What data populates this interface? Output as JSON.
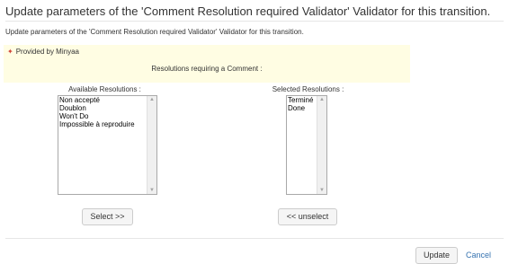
{
  "dialog": {
    "title": "Update parameters of the 'Comment Resolution required Validator' Validator for this transition.",
    "description": "Update parameters of the 'Comment Resolution required Validator' Validator for this transition."
  },
  "plugin": {
    "provided_by": "Provided by Minyaa",
    "icon": "plug-icon"
  },
  "resolutions_label": "Resolutions requiring a Comment :",
  "available": {
    "label": "Available Resolutions :",
    "options": [
      "Non accepté",
      "Doublon",
      "Won't Do",
      "Impossible à reproduire"
    ],
    "button": "Select >>"
  },
  "selected": {
    "label": "Selected Resolutions :",
    "options": [
      "Terminé",
      "Done"
    ],
    "button": "<< unselect"
  },
  "actions": {
    "update": "Update",
    "cancel": "Cancel"
  },
  "colors": {
    "panel_bg": "#fffde3",
    "link": "#3572b0",
    "plug_icon": "#d04437"
  }
}
